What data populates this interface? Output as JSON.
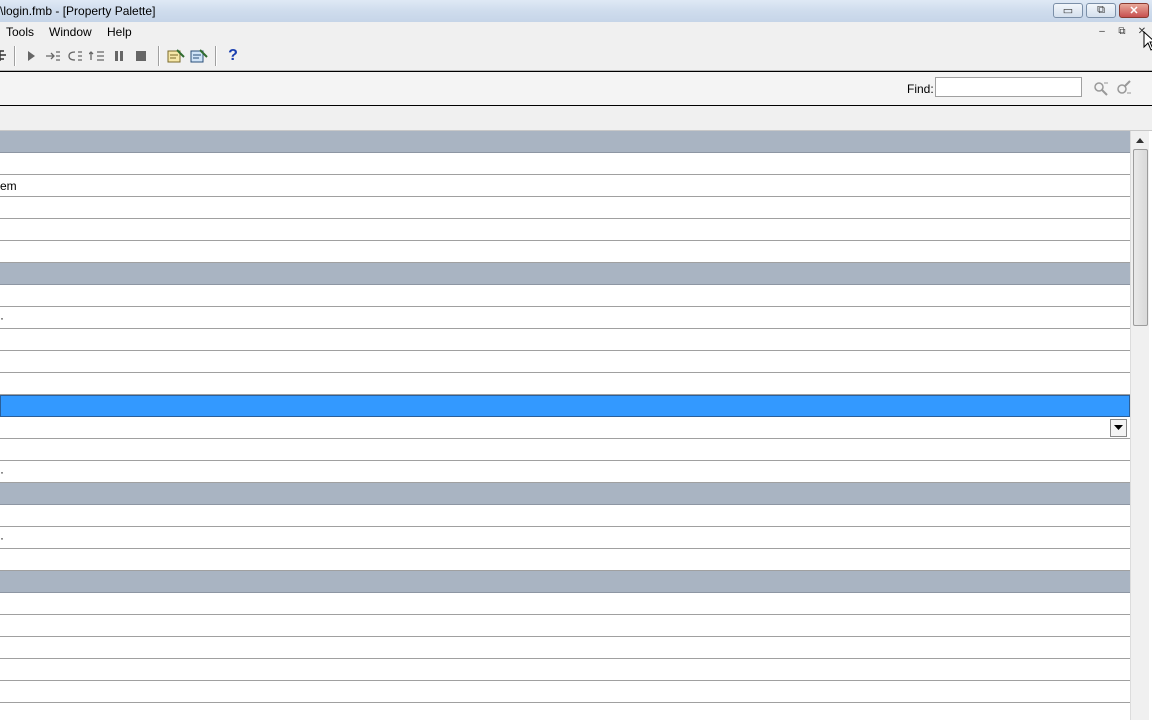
{
  "window": {
    "title": "\\login.fmb - [Property Palette]",
    "minimize": "▭",
    "restore": "⧉",
    "close": "✕"
  },
  "menubar": {
    "items": [
      "Tools",
      "Window",
      "Help"
    ],
    "mdi_minimize": "–",
    "mdi_restore": "⧉",
    "mdi_close": "✕"
  },
  "toolbar": {
    "icons": [
      "tree-icon",
      "run-icon",
      "step-into-icon",
      "step-over-icon",
      "step-out-icon",
      "pause-icon",
      "stop-icon",
      "compile-icon",
      "debug-icon",
      "help-icon"
    ],
    "help_glyph": "?"
  },
  "find": {
    "label": "Find:",
    "value": "",
    "placeholder": ""
  },
  "palette": {
    "rows": [
      {
        "type": "header",
        "text": ""
      },
      {
        "type": "item",
        "text": ""
      },
      {
        "type": "item",
        "text": "em"
      },
      {
        "type": "item",
        "text": ""
      },
      {
        "type": "item",
        "text": ""
      },
      {
        "type": "item",
        "text": ""
      },
      {
        "type": "header",
        "text": ""
      },
      {
        "type": "item",
        "text": ""
      },
      {
        "type": "item",
        "text": "·"
      },
      {
        "type": "item",
        "text": ""
      },
      {
        "type": "item",
        "text": ""
      },
      {
        "type": "item",
        "text": ""
      },
      {
        "type": "selected",
        "text": ""
      },
      {
        "type": "item",
        "text": ""
      },
      {
        "type": "item",
        "text": ""
      },
      {
        "type": "item",
        "text": "·"
      },
      {
        "type": "header",
        "text": ""
      },
      {
        "type": "item",
        "text": ""
      },
      {
        "type": "item",
        "text": "·"
      },
      {
        "type": "item",
        "text": ""
      },
      {
        "type": "header",
        "text": ""
      },
      {
        "type": "item",
        "text": ""
      },
      {
        "type": "item",
        "text": ""
      },
      {
        "type": "item",
        "text": ""
      },
      {
        "type": "item",
        "text": ""
      },
      {
        "type": "item",
        "text": ""
      }
    ]
  },
  "colors": {
    "header_row": "#a9b4c2",
    "selected_row": "#3399ff",
    "help_icon": "#1a3fb0"
  }
}
